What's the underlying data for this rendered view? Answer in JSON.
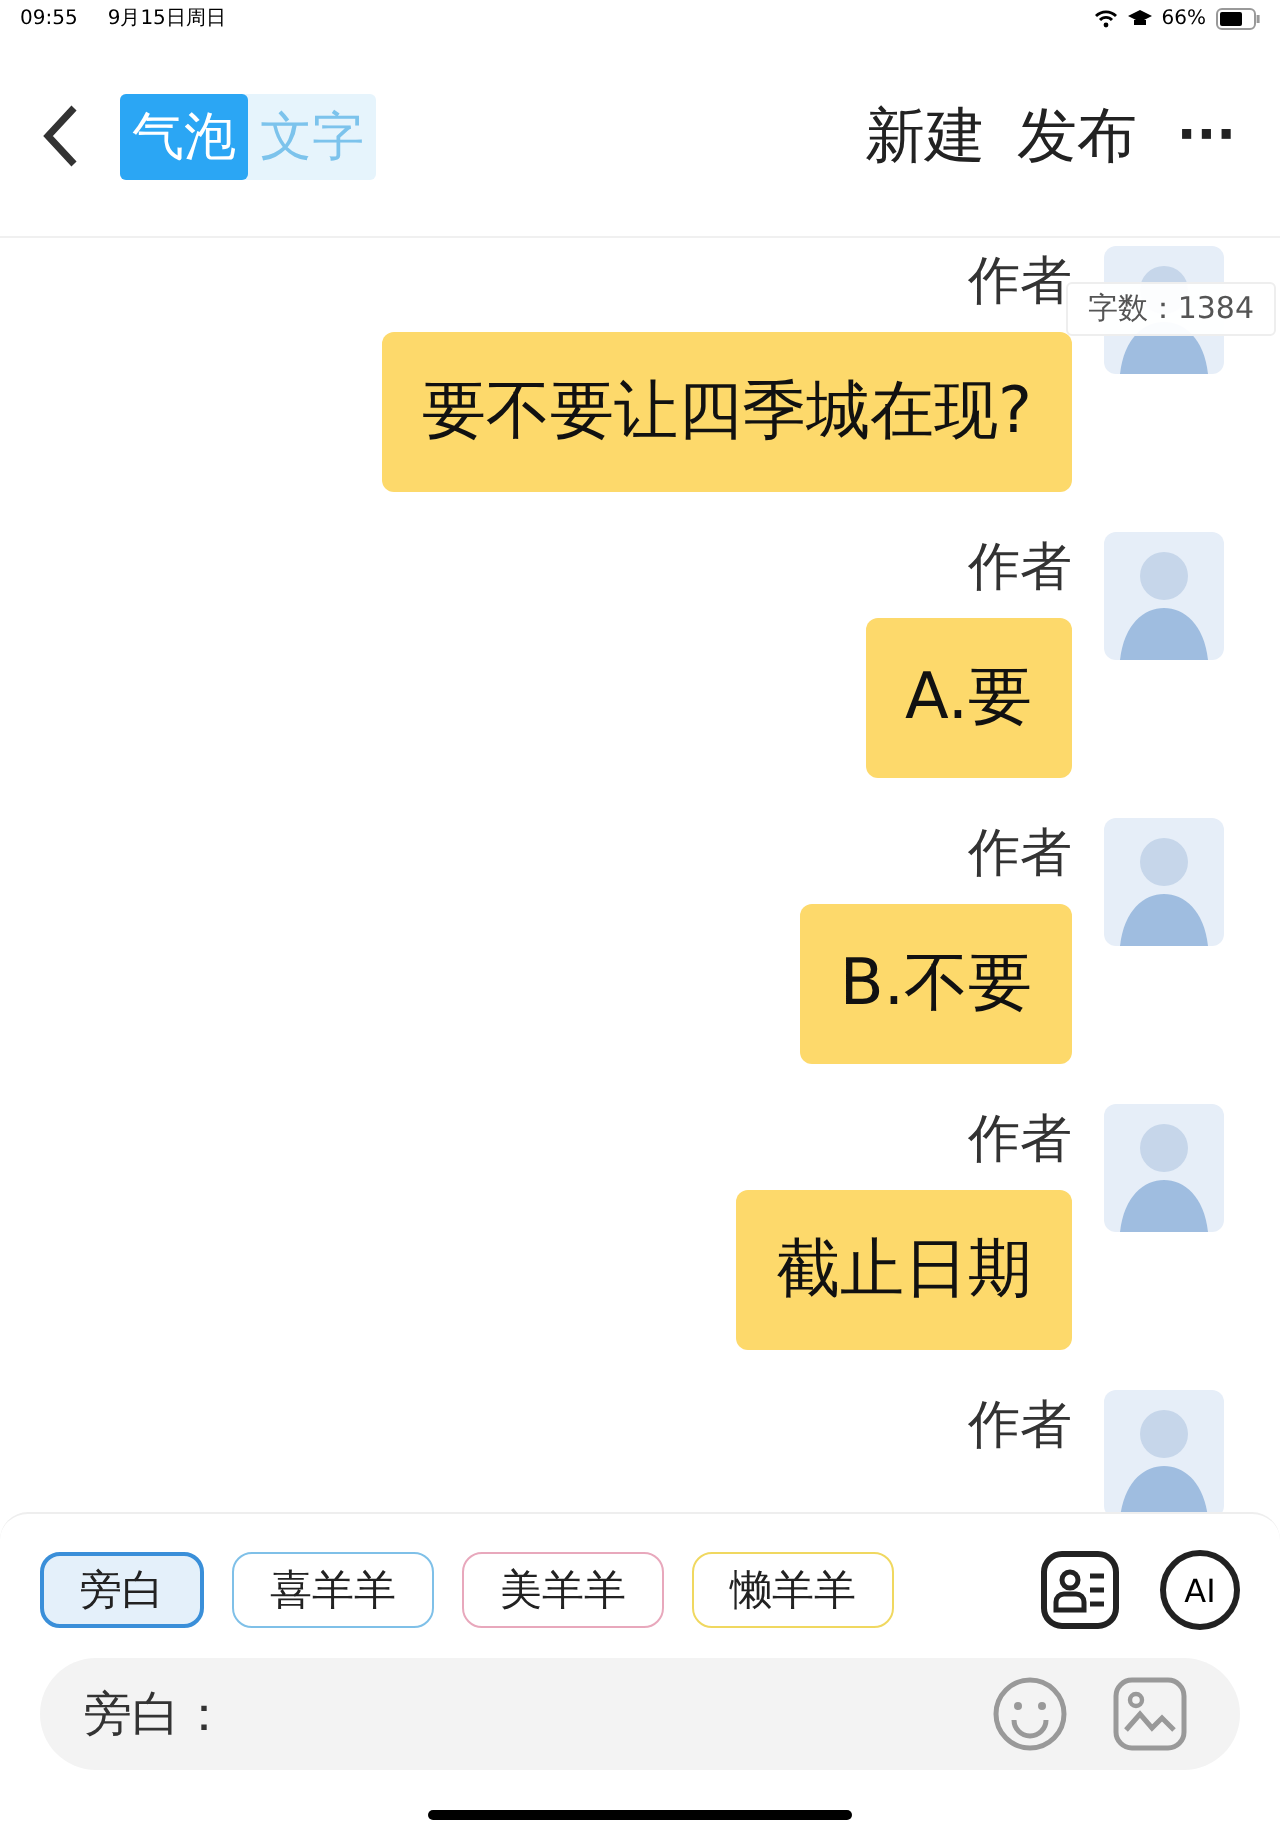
{
  "status_bar": {
    "time": "09:55",
    "date": "9月15日周日",
    "battery": "66%"
  },
  "header": {
    "modes": [
      {
        "label": "气泡",
        "selected": true
      },
      {
        "label": "文字",
        "selected": false
      }
    ],
    "actions": [
      "新建",
      "发布"
    ],
    "more": "···"
  },
  "word_count": "字数：1384",
  "messages": [
    {
      "author": "作者",
      "text": "要不要让四季城在现?"
    },
    {
      "author": "作者",
      "text": "A.要"
    },
    {
      "author": "作者",
      "text": "B.不要"
    },
    {
      "author": "作者",
      "text": "截止日期"
    },
    {
      "author": "作者"
    }
  ],
  "characters": [
    {
      "name": "旁白",
      "color": "#3a8fd9",
      "selected": true
    },
    {
      "name": "喜羊羊",
      "color": "#7fc0e8",
      "selected": false
    },
    {
      "name": "美羊羊",
      "color": "#e8a8bc",
      "selected": false
    },
    {
      "name": "懒羊羊",
      "color": "#f0d860",
      "selected": false
    }
  ],
  "ai_button": "AI",
  "input": {
    "placeholder": "旁白："
  }
}
